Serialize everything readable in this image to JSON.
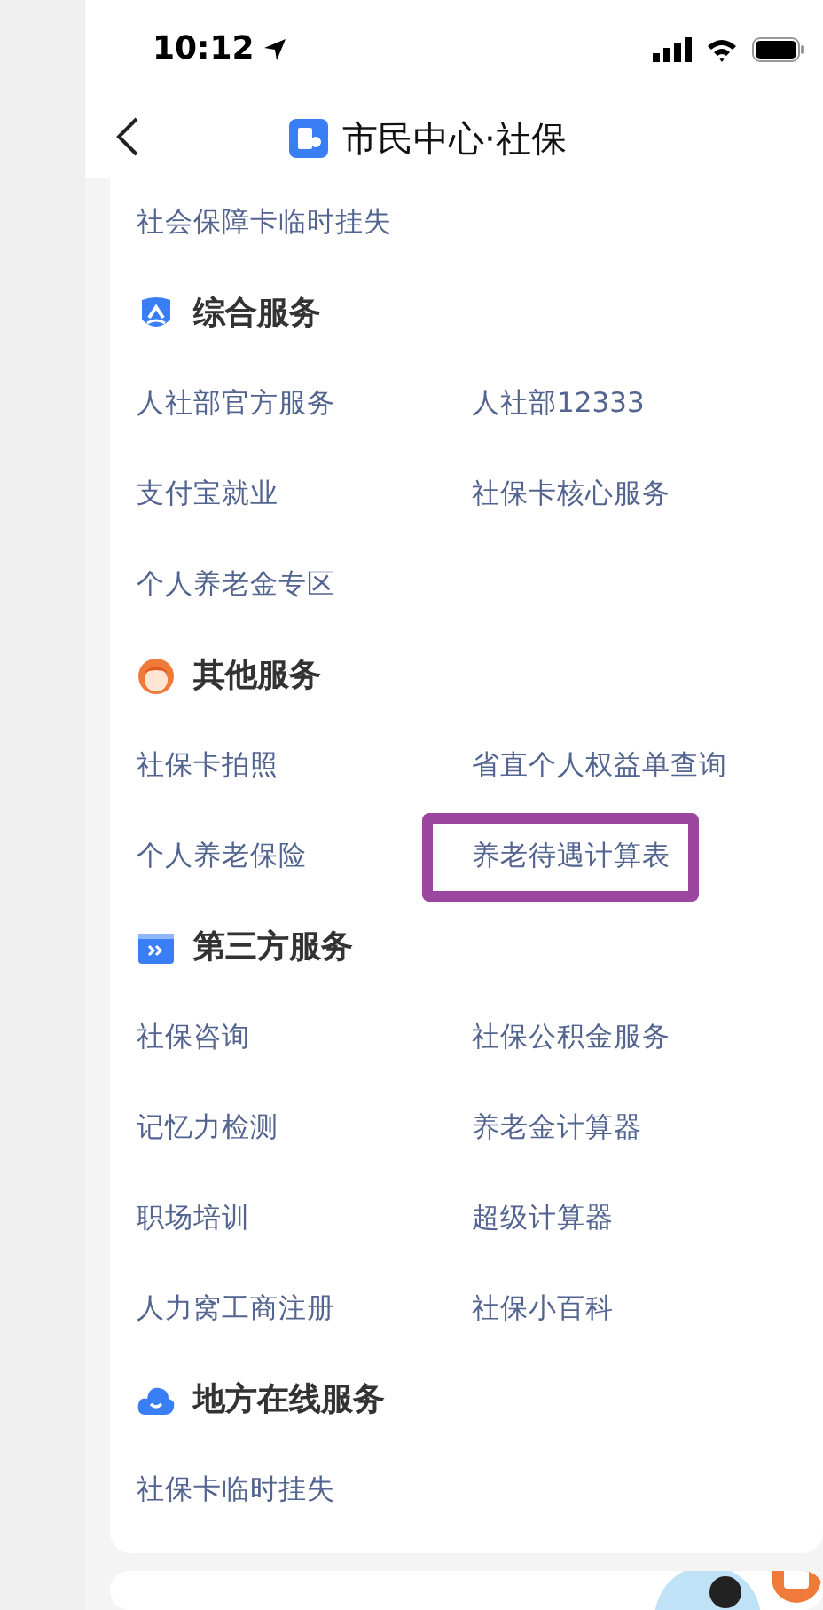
{
  "status_bar": {
    "time": "10:12"
  },
  "nav": {
    "title": "市民中心·社保"
  },
  "top_links": [
    {
      "label": "社会保障卡临时挂失",
      "highlighted": false
    }
  ],
  "sections": [
    {
      "title": "综合服务",
      "kind": "shield",
      "items": [
        {
          "label": "人社部官方服务",
          "highlighted": false
        },
        {
          "label": "人社部12333",
          "highlighted": false
        },
        {
          "label": "支付宝就业",
          "highlighted": false
        },
        {
          "label": "社保卡核心服务",
          "highlighted": false
        },
        {
          "label": "个人养老金专区",
          "highlighted": false
        }
      ]
    },
    {
      "title": "其他服务",
      "kind": "person",
      "items": [
        {
          "label": "社保卡拍照",
          "highlighted": false
        },
        {
          "label": "省直个人权益单查询",
          "highlighted": false
        },
        {
          "label": "个人养老保险",
          "highlighted": false
        },
        {
          "label": "养老待遇计算表",
          "highlighted": true
        }
      ]
    },
    {
      "title": "第三方服务",
      "kind": "card",
      "items": [
        {
          "label": "社保咨询",
          "highlighted": false
        },
        {
          "label": "社保公积金服务",
          "highlighted": false
        },
        {
          "label": "记忆力检测",
          "highlighted": false
        },
        {
          "label": "养老金计算器",
          "highlighted": false
        },
        {
          "label": "职场培训",
          "highlighted": false
        },
        {
          "label": "超级计算器",
          "highlighted": false
        },
        {
          "label": "人力窝工商注册",
          "highlighted": false
        },
        {
          "label": "社保小百科",
          "highlighted": false
        }
      ]
    },
    {
      "title": "地方在线服务",
      "kind": "cloud",
      "items": [
        {
          "label": "社保卡临时挂失",
          "highlighted": false
        }
      ]
    }
  ]
}
